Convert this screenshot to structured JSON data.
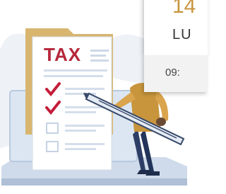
{
  "illustration": {
    "document_title": "TAX"
  },
  "event_card": {
    "day": "14",
    "month": "LU",
    "time": "09:"
  },
  "colors": {
    "tax_red": "#b5273a",
    "check_red": "#c41d3a",
    "gold": "#c8953c",
    "laptop_blue": "#c9d9ea",
    "figure_navy": "#2c3e66"
  }
}
